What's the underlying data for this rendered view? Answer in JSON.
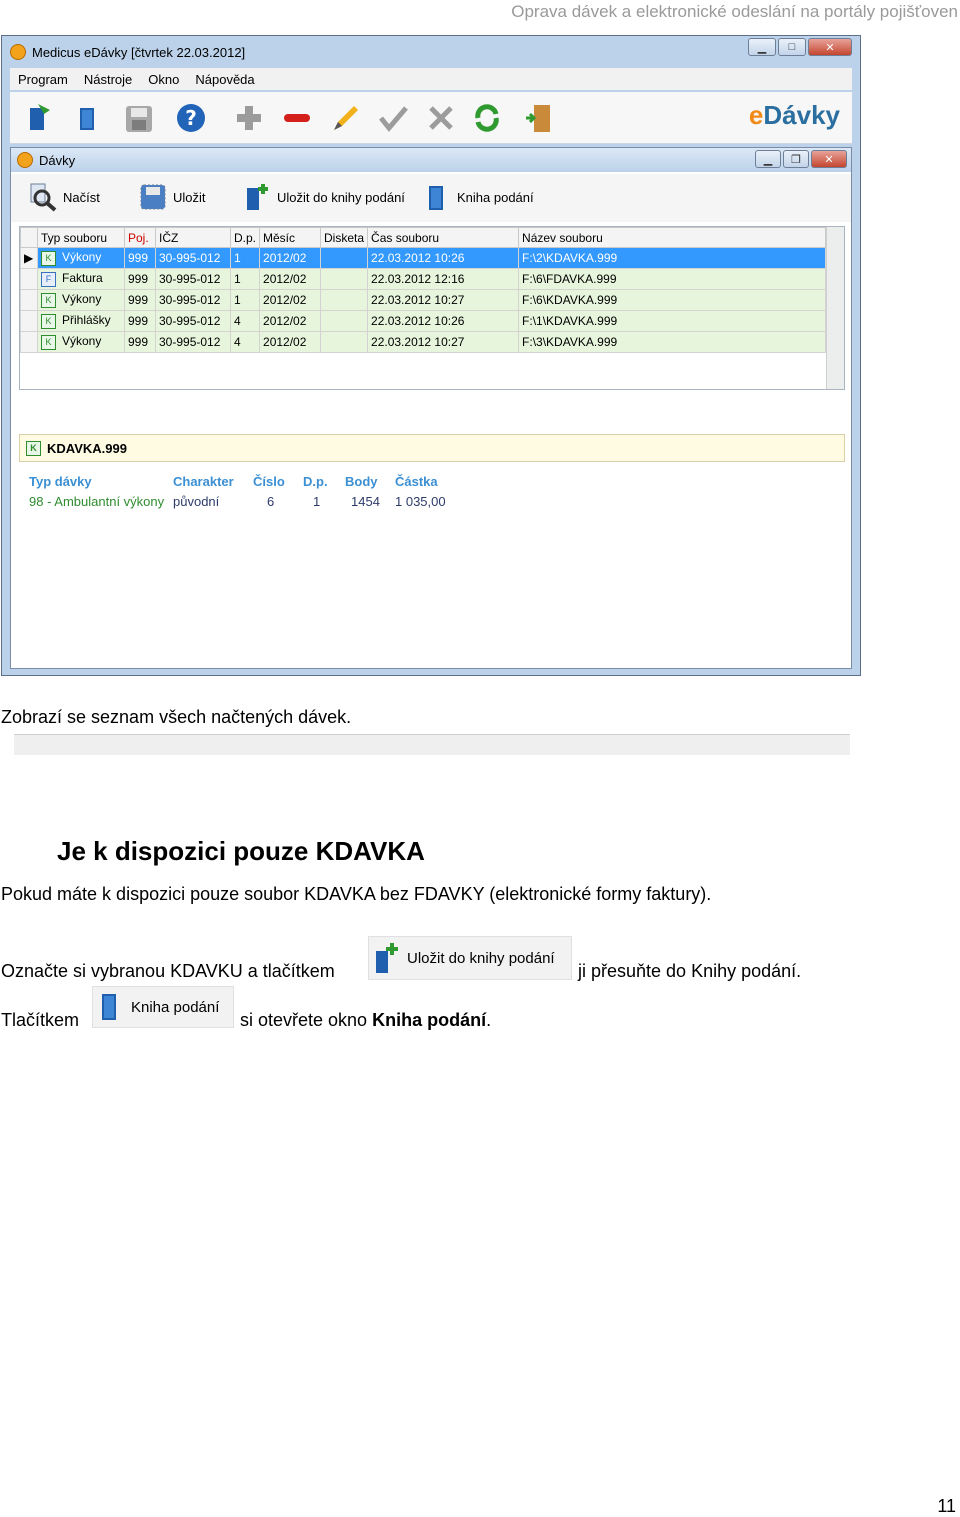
{
  "running_header": "Oprava dávek a elektronické odeslání na portály pojišťoven",
  "window": {
    "title": "Medicus eDávky [čtvrtek 22.03.2012]",
    "menu": [
      "Program",
      "Nástroje",
      "Okno",
      "Nápověda"
    ],
    "logo_text_e": "e",
    "logo_text_rest": "Dávky",
    "subwindow_title": "Dávky",
    "subtoolbar": {
      "load": "Načíst",
      "save": "Uložit",
      "save_to_book": "Uložit do knihy podání",
      "book": "Kniha podání"
    },
    "grid": {
      "columns": [
        "Typ souboru",
        "Poj.",
        "IČZ",
        "D.p.",
        "Měsíc",
        "Disketa",
        "Čas souboru",
        "Název souboru"
      ],
      "rows": [
        {
          "badge": "K",
          "type": "Výkony",
          "poj": "999",
          "icz": "30-995-012",
          "dp": "1",
          "month": "2012/02",
          "disk": "",
          "time": "22.03.2012 10:26",
          "file": "F:\\2\\KDAVKA.999"
        },
        {
          "badge": "F",
          "type": "Faktura",
          "poj": "999",
          "icz": "30-995-012",
          "dp": "1",
          "month": "2012/02",
          "disk": "",
          "time": "22.03.2012 12:16",
          "file": "F:\\6\\FDAVKA.999"
        },
        {
          "badge": "K",
          "type": "Výkony",
          "poj": "999",
          "icz": "30-995-012",
          "dp": "1",
          "month": "2012/02",
          "disk": "",
          "time": "22.03.2012 10:27",
          "file": "F:\\6\\KDAVKA.999"
        },
        {
          "badge": "K",
          "type": "Přihlášky",
          "poj": "999",
          "icz": "30-995-012",
          "dp": "4",
          "month": "2012/02",
          "disk": "",
          "time": "22.03.2012 10:26",
          "file": "F:\\1\\KDAVKA.999"
        },
        {
          "badge": "K",
          "type": "Výkony",
          "poj": "999",
          "icz": "30-995-012",
          "dp": "4",
          "month": "2012/02",
          "disk": "",
          "time": "22.03.2012 10:27",
          "file": "F:\\3\\KDAVKA.999"
        }
      ]
    },
    "detail": {
      "badge": "K",
      "file": "KDAVKA.999",
      "headers": {
        "type": "Typ dávky",
        "character": "Charakter",
        "number": "Číslo",
        "dp": "D.p.",
        "points": "Body",
        "amount": "Částka"
      },
      "values": {
        "type": "98 - Ambulantní výkony",
        "character": "původní",
        "number": "6",
        "dp": "1",
        "points": "1454",
        "amount": "1 035,00"
      }
    }
  },
  "doc": {
    "caption": "Zobrazí se seznam všech načtených dávek.",
    "heading": "Je k dispozici pouze KDAVKA",
    "para1": "Pokud máte k dispozici pouze soubor KDAVKA bez FDAVKY (elektronické formy faktury).",
    "para2_pre": "Označte si vybranou KDAVKU a tlačítkem",
    "para2_btn": "Uložit do knihy podání",
    "para2_post": "ji přesuňte do Knihy podání.",
    "para3_pre": "Tlačítkem",
    "para3_btn": "Kniha podání",
    "para3_mid": "si otevřete okno ",
    "para3_bold": "Kniha podání",
    "para3_end": "."
  },
  "page_number": "11"
}
